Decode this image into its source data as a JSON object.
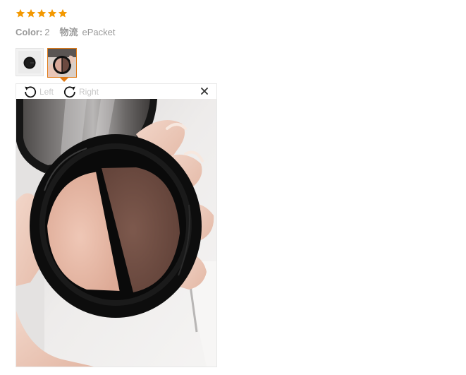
{
  "rating": {
    "stars": 5,
    "star_color": "#f39800"
  },
  "meta": {
    "color_label": "Color:",
    "color_value": "2",
    "shipping_label": "物流",
    "shipping_value": "ePacket"
  },
  "thumbnails": {
    "active_index": 1,
    "active_border_color": "#e07a15"
  },
  "viewer": {
    "rotate_left_label": "Left",
    "rotate_right_label": "Right",
    "close_icon": "close-icon"
  }
}
